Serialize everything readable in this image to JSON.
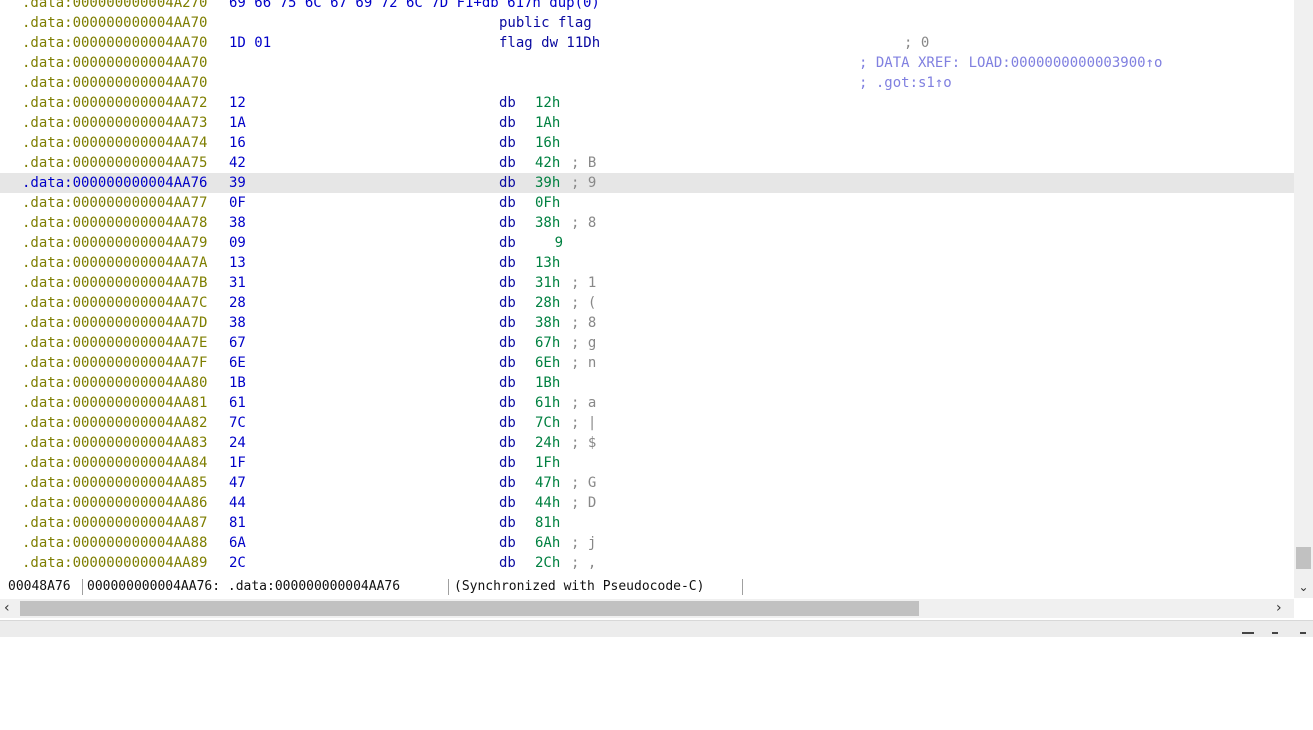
{
  "top_line": {
    "address": ".data:000000000004A270",
    "text": "69 66 75 6C 67 69 72 6C 7D F1+db 617h dup(0)"
  },
  "header_lines": [
    {
      "address": ".data:000000000004AA70",
      "code": "public flag",
      "comment": ""
    },
    {
      "address": ".data:000000000004AA70",
      "bytes": "1D 01",
      "code": "flag dw 11Dh",
      "comment": "; 0"
    },
    {
      "address": ".data:000000000004AA70",
      "comment": "; DATA XREF: LOAD:0000000000003900↑o"
    },
    {
      "address": ".data:000000000004AA70",
      "comment": "; .got:s1↑o"
    }
  ],
  "rows": [
    {
      "address": ".data:000000000004AA72",
      "bytes": "12",
      "mnemonic": "db",
      "operand": "12h",
      "comment": ""
    },
    {
      "address": ".data:000000000004AA73",
      "bytes": "1A",
      "mnemonic": "db",
      "operand": "1Ah",
      "comment": ""
    },
    {
      "address": ".data:000000000004AA74",
      "bytes": "16",
      "mnemonic": "db",
      "operand": "16h",
      "comment": ""
    },
    {
      "address": ".data:000000000004AA75",
      "bytes": "42",
      "mnemonic": "db",
      "operand": "42h",
      "comment": "; B"
    },
    {
      "address": ".data:000000000004AA76",
      "bytes": "39",
      "mnemonic": "db",
      "operand": "39h",
      "comment": "; 9",
      "selected": true
    },
    {
      "address": ".data:000000000004AA77",
      "bytes": "0F",
      "mnemonic": "db",
      "operand": "0Fh",
      "comment": ""
    },
    {
      "address": ".data:000000000004AA78",
      "bytes": "38",
      "mnemonic": "db",
      "operand": "38h",
      "comment": "; 8"
    },
    {
      "address": ".data:000000000004AA79",
      "bytes": "09",
      "mnemonic": "db",
      "operand": "9",
      "comment": "",
      "right_align": true
    },
    {
      "address": ".data:000000000004AA7A",
      "bytes": "13",
      "mnemonic": "db",
      "operand": "13h",
      "comment": ""
    },
    {
      "address": ".data:000000000004AA7B",
      "bytes": "31",
      "mnemonic": "db",
      "operand": "31h",
      "comment": "; 1"
    },
    {
      "address": ".data:000000000004AA7C",
      "bytes": "28",
      "mnemonic": "db",
      "operand": "28h",
      "comment": "; ("
    },
    {
      "address": ".data:000000000004AA7D",
      "bytes": "38",
      "mnemonic": "db",
      "operand": "38h",
      "comment": "; 8"
    },
    {
      "address": ".data:000000000004AA7E",
      "bytes": "67",
      "mnemonic": "db",
      "operand": "67h",
      "comment": "; g"
    },
    {
      "address": ".data:000000000004AA7F",
      "bytes": "6E",
      "mnemonic": "db",
      "operand": "6Eh",
      "comment": "; n"
    },
    {
      "address": ".data:000000000004AA80",
      "bytes": "1B",
      "mnemonic": "db",
      "operand": "1Bh",
      "comment": ""
    },
    {
      "address": ".data:000000000004AA81",
      "bytes": "61",
      "mnemonic": "db",
      "operand": "61h",
      "comment": "; a"
    },
    {
      "address": ".data:000000000004AA82",
      "bytes": "7C",
      "mnemonic": "db",
      "operand": "7Ch",
      "comment": "; |"
    },
    {
      "address": ".data:000000000004AA83",
      "bytes": "24",
      "mnemonic": "db",
      "operand": "24h",
      "comment": "; $"
    },
    {
      "address": ".data:000000000004AA84",
      "bytes": "1F",
      "mnemonic": "db",
      "operand": "1Fh",
      "comment": ""
    },
    {
      "address": ".data:000000000004AA85",
      "bytes": "47",
      "mnemonic": "db",
      "operand": "47h",
      "comment": "; G"
    },
    {
      "address": ".data:000000000004AA86",
      "bytes": "44",
      "mnemonic": "db",
      "operand": "44h",
      "comment": "; D"
    },
    {
      "address": ".data:000000000004AA87",
      "bytes": "81",
      "mnemonic": "db",
      "operand": "81h",
      "comment": ""
    },
    {
      "address": ".data:000000000004AA88",
      "bytes": "6A",
      "mnemonic": "db",
      "operand": "6Ah",
      "comment": "; j"
    },
    {
      "address": ".data:000000000004AA89",
      "bytes": "2C",
      "mnemonic": "db",
      "operand": "2Ch",
      "comment": "; ,"
    }
  ],
  "status": {
    "offset": "00048A76",
    "location": "000000000004AA76: .data:000000000004AA76",
    "sync": "(Synchronized with Pseudocode-C)"
  },
  "icons": {
    "scroll_down": "chevron-down-icon",
    "scroll_left": "chevron-left-icon",
    "scroll_right": "chevron-right-icon"
  },
  "colors": {
    "address": "#7e7e00",
    "selected_address": "#0000c8",
    "bytes": "#0000c8",
    "mnemonic": "#0a0aa0",
    "operand": "#008040",
    "comment": "#888888",
    "xref": "#8080e0",
    "selection_bg": "#e6e6e6"
  }
}
